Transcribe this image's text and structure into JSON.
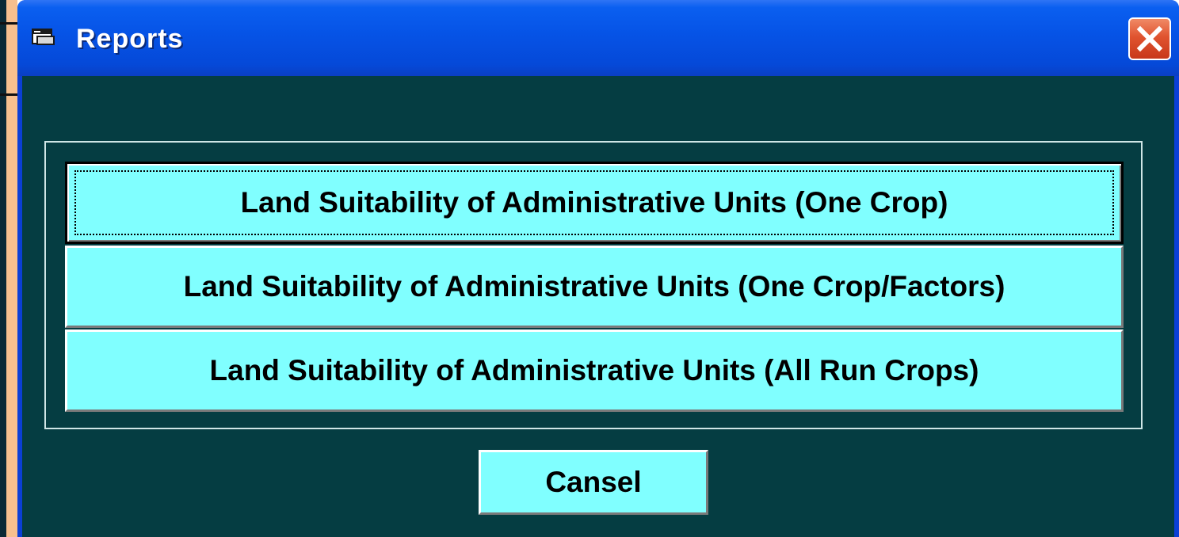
{
  "window": {
    "title": "Reports",
    "icon": "folder-window-icon",
    "close_icon": "close-x-icon"
  },
  "colors": {
    "titlebar": "#0653e6",
    "client_background": "#053d42",
    "button_face": "#80ffff",
    "close_button": "#e0532f"
  },
  "reports": {
    "buttons": [
      {
        "label": "Land Suitability of Administrative Units (One Crop)",
        "focused": true
      },
      {
        "label": "Land Suitability of Administrative Units (One Crop/Factors)",
        "focused": false
      },
      {
        "label": "Land Suitability of Administrative Units (All Run Crops)",
        "focused": false
      }
    ]
  },
  "actions": {
    "cancel_label": "Cansel"
  }
}
